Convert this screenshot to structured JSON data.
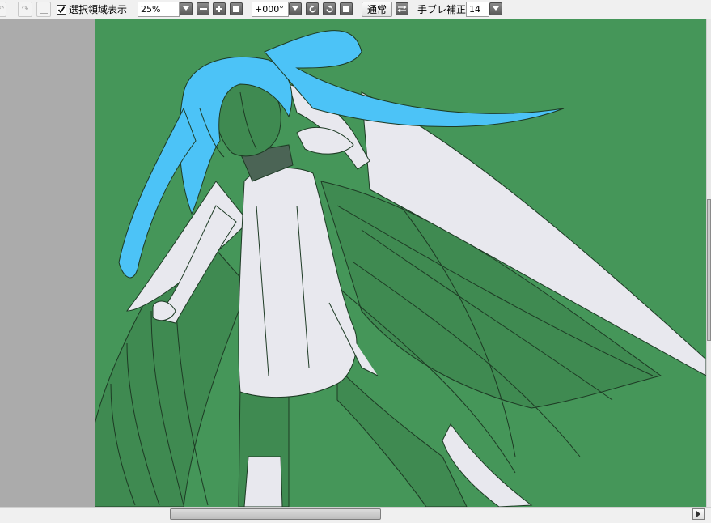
{
  "toolbar": {
    "show_selection_label": "選択領域表示",
    "show_selection_checked": true,
    "zoom_value": "25%",
    "rotation_value": "+000°",
    "blend_mode_label": "通常",
    "stabilizer_label": "手ブレ補正",
    "stabilizer_value": "14"
  },
  "icons": {
    "undo": "undo-icon",
    "redo": "redo-icon",
    "deselect": "deselect-icon",
    "zoom_out": "zoom-out-icon",
    "zoom_in": "zoom-in-icon",
    "zoom_reset": "zoom-reset-icon",
    "rotate_left": "rotate-left-icon",
    "rotate_right": "rotate-right-icon",
    "rotate_reset": "rotate-reset-icon",
    "flip": "flip-horizontal-icon",
    "dropdown": "chevron-down-icon",
    "scroll_right": "arrow-right-icon"
  },
  "colors": {
    "canvas_background": "#459659",
    "hair": "#4cc3f7",
    "outfit": "#e8e8ee",
    "workspace": "#ababab"
  }
}
